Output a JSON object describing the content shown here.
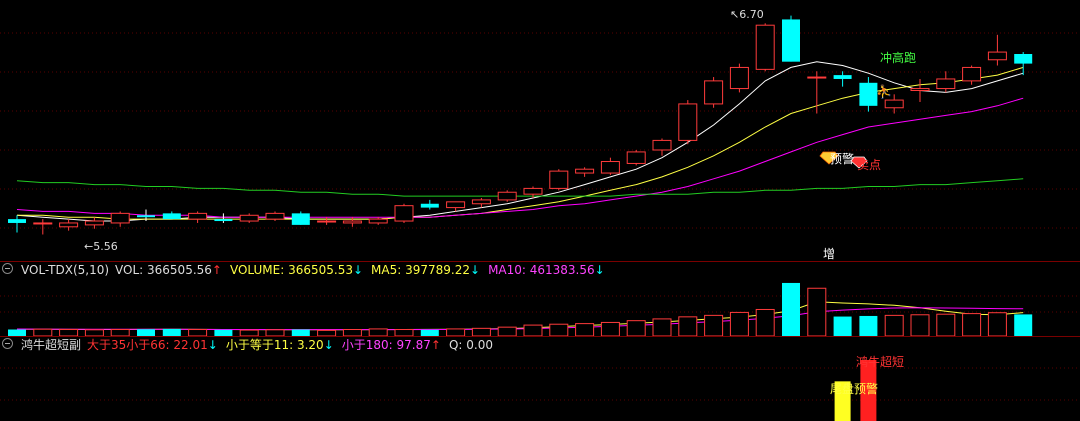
{
  "price_panel": {
    "high_label": "6.70",
    "low_label": "5.56",
    "signal_rush": "冲高跑",
    "signal_warn": "预警",
    "signal_sell": "卖点",
    "signal_add": "增"
  },
  "vol_legend": {
    "name": "VOL-TDX(5,10)",
    "vol": "VOL: 366505.56",
    "vol_arrow": "↑",
    "volume": "VOLUME: 366505.53",
    "volume_arrow": "↓",
    "ma5": "MA5: 397789.22",
    "ma5_arrow": "↓",
    "ma10": "MA10: 461383.56",
    "ma10_arrow": "↓"
  },
  "ind_legend": {
    "name": "鸿牛超短副",
    "g35": "大于35小于66: 22.01",
    "g35_arrow": "↓",
    "le11": "小于等于11: 3.20",
    "le11_arrow": "↓",
    "lt180": "小于180: 97.87",
    "lt180_arrow": "↑",
    "q": "Q: 0.00"
  },
  "ind_panel": {
    "tail_warning": "尾盘预警",
    "bull_short": "鸿牛超短"
  },
  "colors": {
    "up": "#ff3b3b",
    "down": "#00ffff",
    "ma_white": "#ffffff",
    "ma_yellow": "#ffff44",
    "ma_magenta": "#ff00ff",
    "ma_green": "#22cc22",
    "text_yellow": "#ffff44",
    "text_magenta": "#ff44ff",
    "text_red": "#ff3333"
  },
  "chart_data": {
    "type": "candlestick",
    "price_range": [
      5.5,
      6.75
    ],
    "candles": [
      {
        "o": 5.64,
        "h": 5.66,
        "l": 5.57,
        "c": 5.62
      },
      {
        "o": 5.62,
        "h": 5.64,
        "l": 5.56,
        "c": 5.62
      },
      {
        "o": 5.6,
        "h": 5.64,
        "l": 5.58,
        "c": 5.62
      },
      {
        "o": 5.61,
        "h": 5.65,
        "l": 5.59,
        "c": 5.63
      },
      {
        "o": 5.62,
        "h": 5.68,
        "l": 5.6,
        "c": 5.67
      },
      {
        "o": 5.66,
        "h": 5.69,
        "l": 5.63,
        "c": 5.65
      },
      {
        "o": 5.67,
        "h": 5.68,
        "l": 5.64,
        "c": 5.64
      },
      {
        "o": 5.64,
        "h": 5.68,
        "l": 5.62,
        "c": 5.67
      },
      {
        "o": 5.64,
        "h": 5.67,
        "l": 5.62,
        "c": 5.63
      },
      {
        "o": 5.63,
        "h": 5.67,
        "l": 5.62,
        "c": 5.66
      },
      {
        "o": 5.64,
        "h": 5.68,
        "l": 5.63,
        "c": 5.67
      },
      {
        "o": 5.67,
        "h": 5.68,
        "l": 5.61,
        "c": 5.61
      },
      {
        "o": 5.63,
        "h": 5.65,
        "l": 5.61,
        "c": 5.63
      },
      {
        "o": 5.62,
        "h": 5.65,
        "l": 5.6,
        "c": 5.63
      },
      {
        "o": 5.62,
        "h": 5.65,
        "l": 5.61,
        "c": 5.64
      },
      {
        "o": 5.63,
        "h": 5.72,
        "l": 5.62,
        "c": 5.71
      },
      {
        "o": 5.72,
        "h": 5.74,
        "l": 5.69,
        "c": 5.7
      },
      {
        "o": 5.7,
        "h": 5.73,
        "l": 5.68,
        "c": 5.73
      },
      {
        "o": 5.72,
        "h": 5.75,
        "l": 5.7,
        "c": 5.74
      },
      {
        "o": 5.74,
        "h": 5.79,
        "l": 5.73,
        "c": 5.78
      },
      {
        "o": 5.77,
        "h": 5.81,
        "l": 5.75,
        "c": 5.8
      },
      {
        "o": 5.8,
        "h": 5.9,
        "l": 5.79,
        "c": 5.89
      },
      {
        "o": 5.88,
        "h": 5.91,
        "l": 5.86,
        "c": 5.9
      },
      {
        "o": 5.88,
        "h": 5.96,
        "l": 5.87,
        "c": 5.94
      },
      {
        "o": 5.93,
        "h": 6.0,
        "l": 5.92,
        "c": 5.99
      },
      {
        "o": 6.0,
        "h": 6.06,
        "l": 5.97,
        "c": 6.05
      },
      {
        "o": 6.05,
        "h": 6.26,
        "l": 6.03,
        "c": 6.24
      },
      {
        "o": 6.24,
        "h": 6.38,
        "l": 6.22,
        "c": 6.36
      },
      {
        "o": 6.32,
        "h": 6.45,
        "l": 6.3,
        "c": 6.43
      },
      {
        "o": 6.42,
        "h": 6.66,
        "l": 6.41,
        "c": 6.65
      },
      {
        "o": 6.68,
        "h": 6.7,
        "l": 6.46,
        "c": 6.46
      },
      {
        "o": 6.38,
        "h": 6.41,
        "l": 6.19,
        "c": 6.38
      },
      {
        "o": 6.39,
        "h": 6.41,
        "l": 6.33,
        "c": 6.37
      },
      {
        "o": 6.35,
        "h": 6.38,
        "l": 6.2,
        "c": 6.23
      },
      {
        "o": 6.22,
        "h": 6.29,
        "l": 6.19,
        "c": 6.26
      },
      {
        "o": 6.31,
        "h": 6.37,
        "l": 6.25,
        "c": 6.32
      },
      {
        "o": 6.32,
        "h": 6.41,
        "l": 6.3,
        "c": 6.37
      },
      {
        "o": 6.36,
        "h": 6.44,
        "l": 6.34,
        "c": 6.43
      },
      {
        "o": 6.47,
        "h": 6.6,
        "l": 6.44,
        "c": 6.51
      },
      {
        "o": 6.5,
        "h": 6.51,
        "l": 6.39,
        "c": 6.45
      }
    ],
    "ma_lines": {
      "white": [
        5.66,
        5.65,
        5.64,
        5.63,
        5.63,
        5.64,
        5.64,
        5.65,
        5.65,
        5.65,
        5.65,
        5.64,
        5.64,
        5.64,
        5.64,
        5.65,
        5.66,
        5.68,
        5.7,
        5.72,
        5.75,
        5.78,
        5.82,
        5.86,
        5.9,
        5.96,
        6.04,
        6.13,
        6.24,
        6.36,
        6.43,
        6.46,
        6.44,
        6.4,
        6.35,
        6.31,
        6.3,
        6.32,
        6.36,
        6.4
      ],
      "yellow": [
        5.66,
        5.66,
        5.65,
        5.65,
        5.64,
        5.64,
        5.64,
        5.64,
        5.64,
        5.64,
        5.64,
        5.64,
        5.64,
        5.64,
        5.64,
        5.65,
        5.65,
        5.66,
        5.67,
        5.69,
        5.71,
        5.73,
        5.76,
        5.79,
        5.82,
        5.86,
        5.91,
        5.97,
        6.04,
        6.12,
        6.19,
        6.23,
        6.27,
        6.3,
        6.32,
        6.34,
        6.35,
        6.37,
        6.39,
        6.43
      ],
      "magenta": [
        5.69,
        5.68,
        5.68,
        5.67,
        5.67,
        5.66,
        5.66,
        5.66,
        5.65,
        5.65,
        5.65,
        5.65,
        5.65,
        5.65,
        5.65,
        5.65,
        5.65,
        5.66,
        5.67,
        5.68,
        5.69,
        5.71,
        5.72,
        5.74,
        5.76,
        5.78,
        5.81,
        5.85,
        5.89,
        5.94,
        5.99,
        6.04,
        6.08,
        6.12,
        6.14,
        6.16,
        6.18,
        6.2,
        6.23,
        6.27
      ],
      "green": [
        5.84,
        5.83,
        5.83,
        5.82,
        5.82,
        5.81,
        5.81,
        5.8,
        5.8,
        5.79,
        5.79,
        5.78,
        5.78,
        5.77,
        5.77,
        5.76,
        5.76,
        5.76,
        5.76,
        5.76,
        5.76,
        5.76,
        5.76,
        5.76,
        5.77,
        5.77,
        5.77,
        5.78,
        5.78,
        5.79,
        5.79,
        5.8,
        5.8,
        5.81,
        5.81,
        5.82,
        5.82,
        5.83,
        5.84,
        5.85
      ]
    },
    "volume_range": [
      0,
      950000
    ],
    "volume": [
      110000,
      115000,
      110000,
      105000,
      110000,
      115000,
      120000,
      110000,
      105000,
      100000,
      105000,
      110000,
      95000,
      110000,
      120000,
      110000,
      105000,
      120000,
      130000,
      150000,
      185000,
      200000,
      210000,
      230000,
      260000,
      290000,
      325000,
      350000,
      400000,
      450000,
      900000,
      810000,
      330000,
      340000,
      350000,
      360000,
      370000,
      380000,
      395000,
      366505
    ],
    "vol_ma5": [
      115000,
      114000,
      112000,
      111000,
      110000,
      112000,
      113000,
      112000,
      110000,
      108000,
      106000,
      107000,
      106000,
      107000,
      108000,
      110000,
      112000,
      114000,
      118000,
      125000,
      140000,
      160000,
      178000,
      195000,
      215000,
      238000,
      265000,
      292000,
      320000,
      365000,
      430000,
      580000,
      560000,
      545000,
      520000,
      480000,
      420000,
      370000,
      360000,
      397789
    ],
    "vol_ma10": [
      118000,
      117000,
      116000,
      115000,
      114000,
      113000,
      113000,
      112000,
      111000,
      110000,
      109000,
      108000,
      108000,
      108000,
      108000,
      109000,
      110000,
      111000,
      113000,
      118000,
      126000,
      138000,
      150000,
      165000,
      182000,
      200000,
      222000,
      245000,
      270000,
      300000,
      345000,
      410000,
      440000,
      460000,
      475000,
      480000,
      475000,
      470000,
      465000,
      461383
    ],
    "indicator_bars": [
      {
        "index": 32,
        "value": 0.65,
        "color": "yellow"
      },
      {
        "index": 33,
        "value": 1.0,
        "color": "red"
      }
    ]
  }
}
